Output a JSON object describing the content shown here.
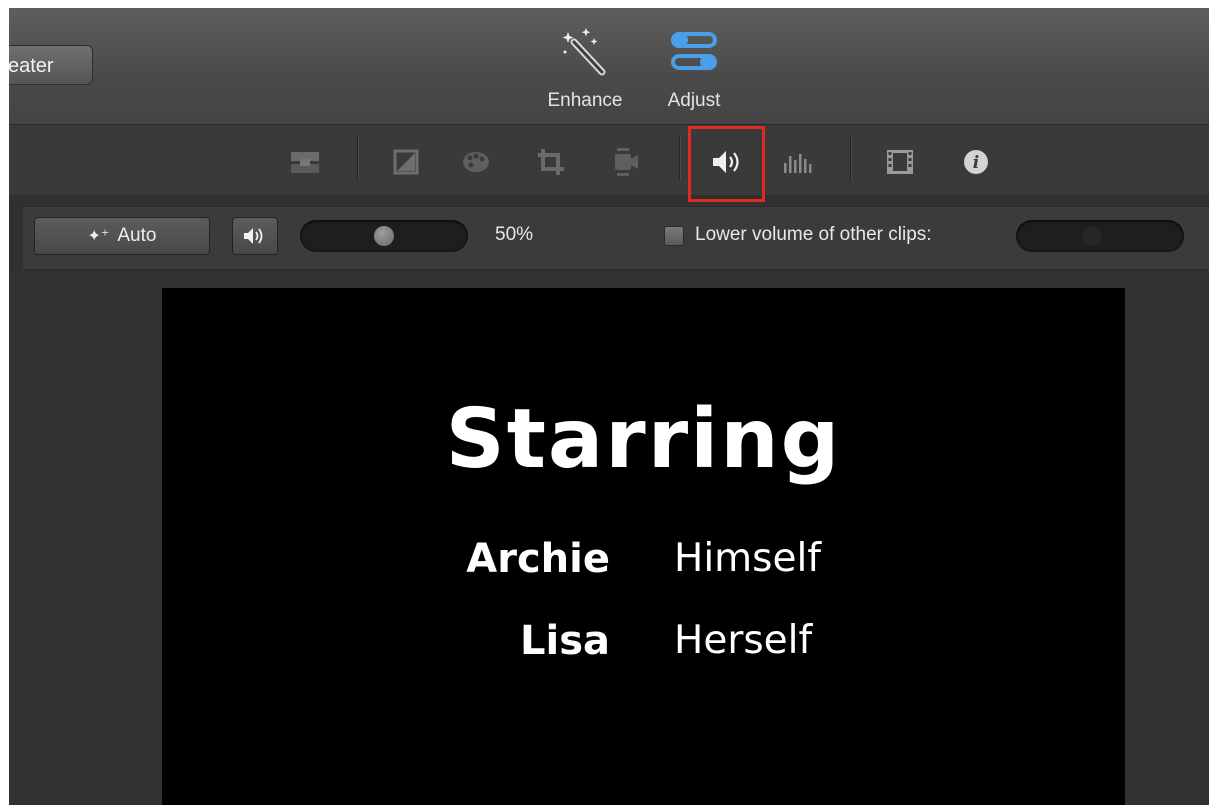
{
  "toolbar": {
    "theater_label": "eater",
    "enhance_label": "Enhance",
    "adjust_label": "Adjust",
    "adjust_color": "#4a9fe8"
  },
  "adjust_bar": {
    "icons": [
      "clip-filter-icon",
      "color-balance-icon",
      "color-correction-icon",
      "crop-icon",
      "stabilization-icon",
      "volume-icon",
      "noise-reduction-equalizer-icon",
      "speed-icon",
      "clip-info-icon"
    ],
    "selected": "volume-icon",
    "highlight_color": "#e02a20"
  },
  "volume": {
    "auto_label": "Auto",
    "value_label": "50%",
    "value": 0.5,
    "lower_checkbox_checked": false,
    "lower_label": "Lower volume of other clips:"
  },
  "viewer": {
    "title": "Starring",
    "credits": [
      {
        "role": "Archie",
        "name": "Himself"
      },
      {
        "role": "Lisa",
        "name": "Herself"
      }
    ]
  }
}
